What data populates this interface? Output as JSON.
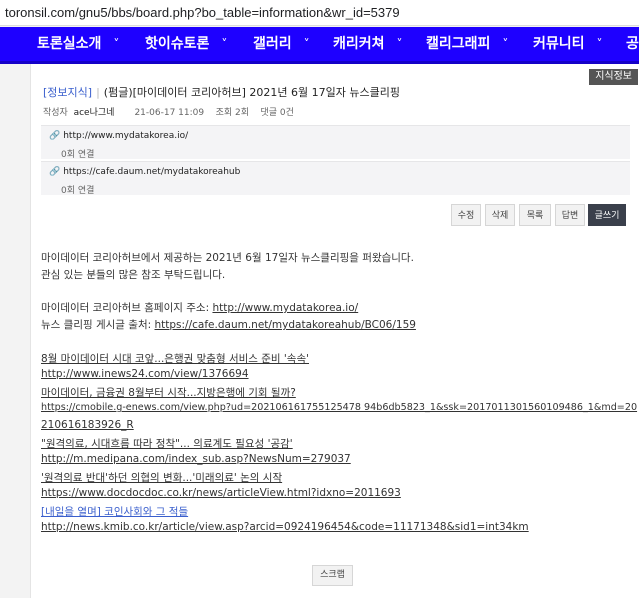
{
  "browser": {
    "url": "toronsil.com/gnu5/bbs/board.php?bo_table=information&wr_id=5379"
  },
  "nav": {
    "items": [
      {
        "label": "토론실소개",
        "chevron": "˅"
      },
      {
        "label": "핫이슈토론",
        "chevron": "˅"
      },
      {
        "label": "갤러리",
        "chevron": "˅"
      },
      {
        "label": "캐리커쳐",
        "chevron": "˅"
      },
      {
        "label": "캘리그래피",
        "chevron": "˅"
      },
      {
        "label": "커뮤니티",
        "chevron": "˅"
      },
      {
        "label": "공",
        "chevron": ""
      }
    ]
  },
  "post": {
    "category_badge": "지식정보",
    "category": "[정보지식]",
    "separator": "|",
    "title": "(펌글)[마이데이터 코리아허브] 2021년 6월 17일자 뉴스클리핑",
    "author_label": "작성자",
    "author": "ace나그네",
    "date": "21-06-17 11:09",
    "views": "조회 2회",
    "comments": "댓글 0건"
  },
  "links": [
    {
      "url": "http://www.mydatakorea.io/",
      "count": "0회 연결"
    },
    {
      "url": "https://cafe.daum.net/mydatakoreahub",
      "count": "0회 연결"
    }
  ],
  "buttons": {
    "edit": "수정",
    "delete": "삭제",
    "list": "목록",
    "reply": "답변",
    "write": "글쓰기"
  },
  "body": {
    "intro1": "마이데이터 코리아허브에서 제공하는 2021년 6월 17일자 뉴스클리핑을 퍼왔습니다.",
    "intro2": "관심 있는 분들의 많은 참조 부탁드립니다.",
    "homepage_label": "마이데이터 코리아허브 홈페이지 주소: ",
    "homepage_url": "http://www.mydatakorea.io/",
    "source_label": "뉴스 클리핑 게시글 출처: ",
    "source_url": "https://cafe.daum.net/mydatakoreahub/BC06/159",
    "news": [
      {
        "title": "8월 마이데이터 시대 코앞...은행권 맞춤형 서비스 준비 '속속'",
        "url": "http://www.inews24.com/view/1376694"
      },
      {
        "title": "마이데이터, 금융권 8월부터 시작...지방은행에 기회 될까?",
        "url": "https://cmobile.g-enews.com/view.php?ud=202106161755125478 94b6db5823_1&ssk=2017011301560109486_1&md=20",
        "url2": "210616183926_R"
      },
      {
        "title": "\"원격의료, 시대흐름 따라 정착\"... 의료계도 필요성 '공감'",
        "url": "http://m.medipana.com/index_sub.asp?NewsNum=279037"
      },
      {
        "title": "'원격의료 반대'하던 의협의 변화...'미래의료' 논의 시작",
        "url": "https://www.docdocdoc.co.kr/news/articleView.html?idxno=2011693"
      },
      {
        "title": "[내일을 열며] 코인사회와 그 적들",
        "url": "http://news.kmib.co.kr/article/view.asp?arcid=0924196454&code=11171348&sid1=int34km"
      }
    ]
  },
  "scrap_button": "스크랩"
}
